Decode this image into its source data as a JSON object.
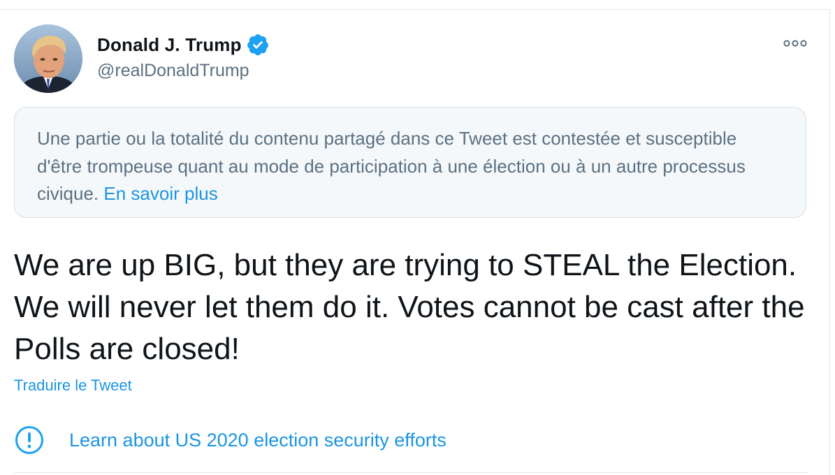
{
  "tweet": {
    "author": {
      "display_name": "Donald J. Trump",
      "handle": "@realDonaldTrump",
      "verified": true,
      "verified_color": "#1da1f2"
    },
    "notice": {
      "text": "Une partie ou la totalité du contenu partagé dans ce Tweet est contestée et susceptible d'être trompeuse quant au mode de participation à une élection ou à un autre processus civique.",
      "link_label": "En savoir plus"
    },
    "body": "We are up BIG, but they are trying to STEAL the Election. We will never let them do it. Votes cannot be cast after the Polls are closed!",
    "translate_label": "Traduire le Tweet",
    "election_label": "Learn about US 2020 election security efforts"
  },
  "icons": {
    "more": "more-horizontal-icon",
    "verified": "verified-badge-icon",
    "alert": "exclamation-circle-icon"
  },
  "colors": {
    "accent": "#1b95e0",
    "muted": "#5b7083",
    "notice_bg": "#f5f8fa",
    "border": "#e1e8ed"
  }
}
